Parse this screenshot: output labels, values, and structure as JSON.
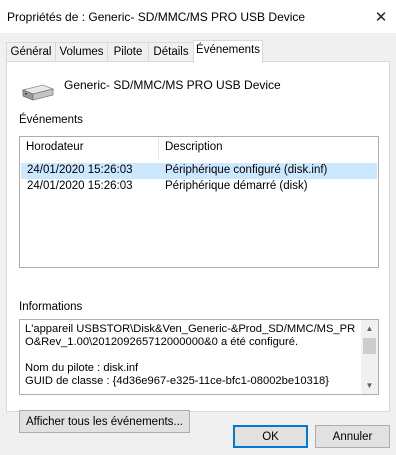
{
  "window": {
    "title": "Propriétés de : Generic- SD/MMC/MS PRO USB Device",
    "close_glyph": "✕"
  },
  "tabs": [
    {
      "label": "Général",
      "active": false
    },
    {
      "label": "Volumes",
      "active": false
    },
    {
      "label": "Pilote",
      "active": false
    },
    {
      "label": "Détails",
      "active": false
    },
    {
      "label": "Événements",
      "active": true
    }
  ],
  "device": {
    "icon": "usb-drive-icon",
    "name": "Generic- SD/MMC/MS PRO USB Device"
  },
  "events": {
    "section_label": "Événements",
    "columns": [
      "Horodateur",
      "Description"
    ],
    "rows": [
      {
        "timestamp": "24/01/2020 15:26:03",
        "description": "Périphérique configuré (disk.inf)",
        "selected": true
      },
      {
        "timestamp": "24/01/2020 15:26:03",
        "description": "Périphérique démarré (disk)",
        "selected": false
      }
    ]
  },
  "information": {
    "section_label": "Informations",
    "paragraph1": "L'appareil USBSTOR\\Disk&Ven_Generic-&Prod_SD/MMC/MS_PRO&Rev_1.00\\201209265712000000&0 a été configuré.",
    "paragraph2_line1": "Nom du pilote : disk.inf",
    "paragraph2_line2": "GUID de classe : {4d36e967-e325-11ce-bfc1-08002be10318}"
  },
  "buttons": {
    "show_all_events": "Afficher tous les événements...",
    "ok": "OK",
    "cancel": "Annuler"
  },
  "colors": {
    "selection": "#cce8ff",
    "accent": "#0078d7",
    "panel_bg": "#ffffff",
    "dialog_bg": "#f0f0f0"
  }
}
